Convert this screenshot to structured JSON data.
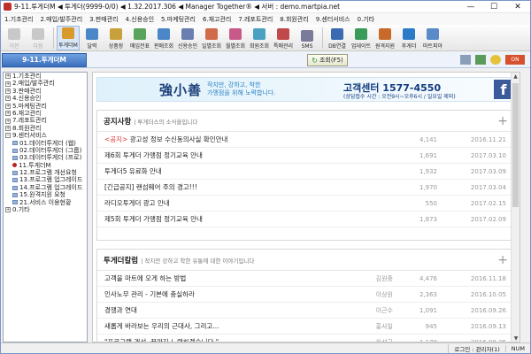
{
  "window": {
    "title": "9-11.투게더M ◀ 투게더(9999-0/0) ◀ 1.32.2017.306 ◀ Manager Together® ◀ 서버 : demo.martpia.net",
    "min": "—",
    "max": "☐",
    "close": "✕"
  },
  "menu": [
    "1.기초관리",
    "2.매입/발주관리",
    "3.판매관리",
    "4.신용승인",
    "5.마케팅관리",
    "6.재고관리",
    "7.레포트관리",
    "8.회원관리",
    "9.센터서비스",
    "0.기타"
  ],
  "toolbar": [
    {
      "label": "이전",
      "icon": "back-arrow-icon",
      "disabled": true,
      "color": "#c8c8c8"
    },
    {
      "label": "다음",
      "icon": "forward-arrow-icon",
      "disabled": true,
      "color": "#c8c8c8"
    },
    {
      "label": "투게더M",
      "icon": "together-m-icon",
      "active": true,
      "color": "#d89a2a"
    },
    {
      "label": "달력",
      "icon": "calendar-icon",
      "color": "#4a86c8"
    },
    {
      "label": "상품장",
      "icon": "product-ledger-icon",
      "color": "#c9a13c"
    },
    {
      "label": "매입전표",
      "icon": "purchase-slip-icon",
      "color": "#5aa35a"
    },
    {
      "label": "판매조회",
      "icon": "sales-query-icon",
      "color": "#4a86c8"
    },
    {
      "label": "신용승인",
      "icon": "credit-card-icon",
      "color": "#6a7fb0"
    },
    {
      "label": "일별조회",
      "icon": "daily-query-icon",
      "color": "#d06a4a"
    },
    {
      "label": "월별조회",
      "icon": "monthly-query-icon",
      "color": "#c85a8a"
    },
    {
      "label": "회원조회",
      "icon": "member-query-icon",
      "color": "#4aa0c0"
    },
    {
      "label": "특매관리",
      "icon": "special-sale-icon",
      "color": "#c04a4a"
    },
    {
      "label": "SMS",
      "icon": "sms-icon",
      "color": "#7a7a9a"
    },
    {
      "label": "DB연결",
      "icon": "db-connect-icon",
      "color": "#3a6ab0"
    },
    {
      "label": "업데이트",
      "icon": "update-icon",
      "color": "#3a9a5a"
    },
    {
      "label": "원격지원",
      "icon": "remote-support-icon",
      "color": "#c86a2a"
    },
    {
      "label": "후게더",
      "icon": "data-together-icon",
      "color": "#2a7ac8"
    },
    {
      "label": "마트피아",
      "icon": "martpia-icon",
      "color": "#5a8ac8"
    }
  ],
  "current_tab": "9-11.투게더M",
  "search_button": "조회(F5)",
  "status_off": "ON",
  "tree": [
    {
      "label": "1.기초관리",
      "level": 0,
      "toggle": "+"
    },
    {
      "label": "2.매입/발주관리",
      "level": 0,
      "toggle": "+"
    },
    {
      "label": "3.판매관리",
      "level": 0,
      "toggle": "+"
    },
    {
      "label": "4.신용승인",
      "level": 0,
      "toggle": "+"
    },
    {
      "label": "5.마케팅관리",
      "level": 0,
      "toggle": "+"
    },
    {
      "label": "6.재고관리",
      "level": 0,
      "toggle": "+"
    },
    {
      "label": "7.레포트관리",
      "level": 0,
      "toggle": "+"
    },
    {
      "label": "8.회원관리",
      "level": 0,
      "toggle": "+"
    },
    {
      "label": "9.센터서비스",
      "level": 0,
      "toggle": "−"
    },
    {
      "label": "01.데이터투게더 (웹)",
      "level": 1
    },
    {
      "label": "02.데이터투게더 (그룹)",
      "level": 1
    },
    {
      "label": "03.데이터투게더 (프로)",
      "level": 1
    },
    {
      "label": "11.투게더M",
      "level": 1,
      "selected": true
    },
    {
      "label": "12.프로그램 개선요청",
      "level": 1
    },
    {
      "label": "13.프로그램 업그레이드",
      "level": 1
    },
    {
      "label": "14.프로그램 업그레이드",
      "level": 1
    },
    {
      "label": "15.원격지원 요청",
      "level": 1
    },
    {
      "label": "21.서비스 이용현황",
      "level": 1
    },
    {
      "label": "0.기타",
      "level": 0,
      "toggle": "+"
    }
  ],
  "banner": {
    "logo": "強小善",
    "tagline1": "작지만, 강하고, 착한",
    "tagline2": "가맹점을 위해 노력합니다.",
    "contact": "고객센터 1577-4550",
    "hours": "(상담접수 시간 : 오전9시~오후6시 / 일요일 제외)",
    "fb": "f"
  },
  "notices": {
    "title": "공지사항",
    "subtitle": "| 투게더스의 소식을입니다",
    "plus": "+",
    "rows": [
      {
        "prefix": "<공지>",
        "title": " 광고성 정보 수신동의사실 확인안내",
        "views": "4,141",
        "date": "2016.11.21"
      },
      {
        "title": "제6회 투게더 가맹점 정기교육 안내",
        "views": "1,691",
        "date": "2017.03.10"
      },
      {
        "title": "투게더5 유료화 안내",
        "views": "1,932",
        "date": "2017.03.09"
      },
      {
        "title": "[긴급공지] 랜섬웨어 주의 경고!!!",
        "views": "1,970",
        "date": "2017.03.04"
      },
      {
        "title": "라디오투게더 광고 안내",
        "views": "550",
        "date": "2017.02.15"
      },
      {
        "title": "제5회 투게더 가맹점 정기교육 안내",
        "views": "1,873",
        "date": "2017.02.09"
      }
    ]
  },
  "columns": {
    "title": "투게더칼럼",
    "subtitle": "| 작지만 강하고 착한 유통에 대한 이야기입니다",
    "plus": "+",
    "rows": [
      {
        "title": "고객을 마트에 오게 하는 방법",
        "author": "김원중",
        "views": "4,476",
        "date": "2016.11.18"
      },
      {
        "title": "인사노무 관리 - 기본에 충실하라",
        "author": "이상원",
        "views": "2,363",
        "date": "2016.10.05"
      },
      {
        "title": "경쟁과 연대",
        "author": "이근수",
        "views": "1,091",
        "date": "2016.09.26"
      },
      {
        "title": "새롭게 바라보는 우리의 근대사, 그리고...",
        "author": "홍사일",
        "views": "945",
        "date": "2016.09.13"
      },
      {
        "title": "\"프로그램 개선, 끝까지 노력하겠습니다.\"",
        "author": "윤석근",
        "views": "1,179",
        "date": "2016.08.25"
      }
    ]
  },
  "statusbar": {
    "login": "로그인 : 관리자(1)",
    "num": "NUM"
  }
}
